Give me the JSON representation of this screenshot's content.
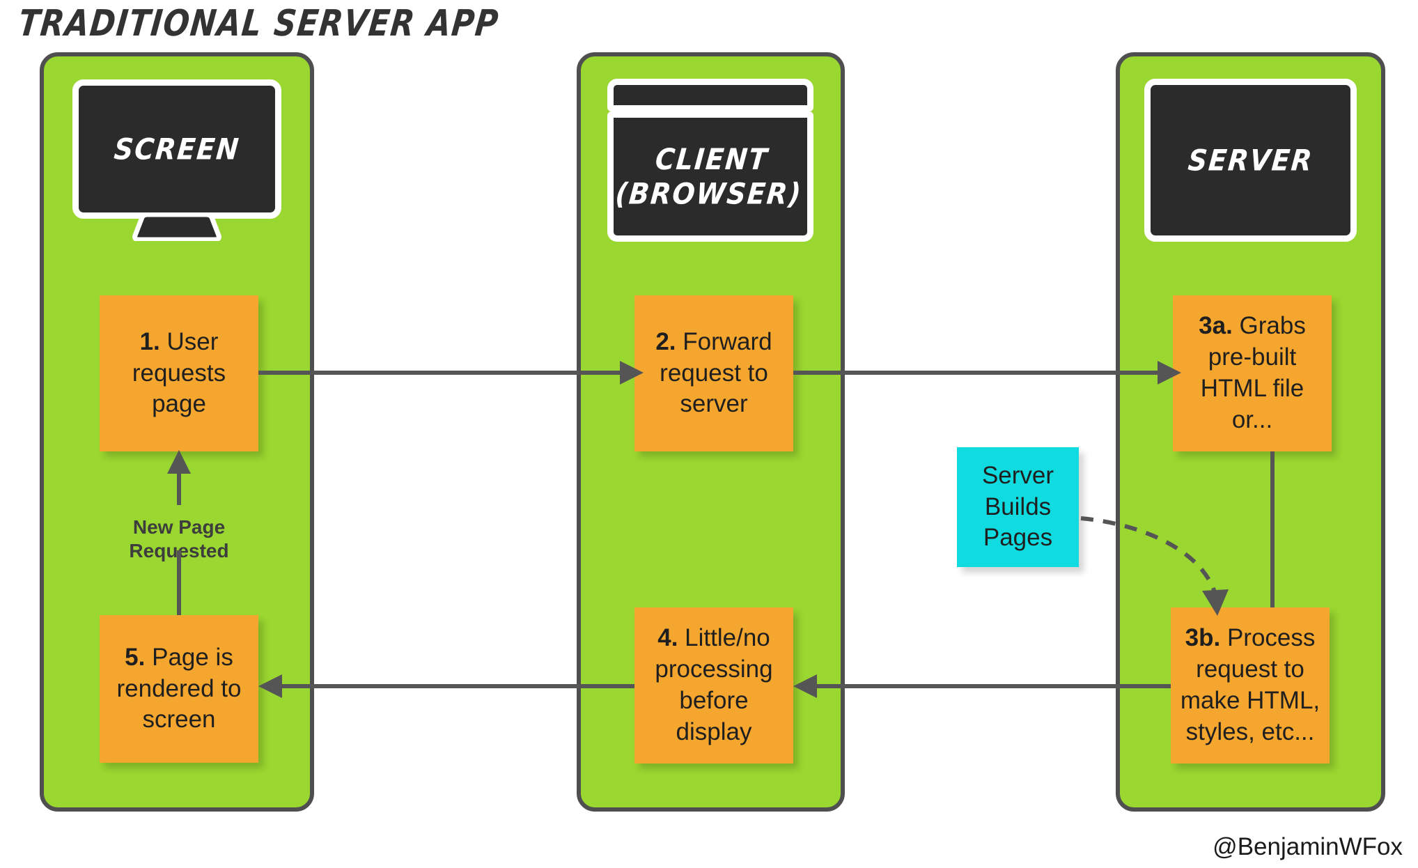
{
  "title": "TRADITIONAL SERVER APP",
  "attribution": "@BenjaminWFox",
  "colors": {
    "lane_green": "#9ad730",
    "lane_border": "#4f4f4f",
    "step_orange": "#f5a62e",
    "note_cyan": "#0fdbe0",
    "device_dark": "#2b2b2b",
    "connector_gray": "#555555",
    "text_dark": "#1f1f1f",
    "device_label_white": "#ffffff"
  },
  "lanes": [
    {
      "id": "screen",
      "device_label": "SCREEN",
      "device_icon": "monitor-icon",
      "steps": [
        {
          "id": "step1",
          "number": "1.",
          "text": "User requests page",
          "full": "1. User requests page"
        },
        {
          "id": "step5",
          "number": "5.",
          "text": "Page is rendered to screen",
          "full": "5. Page is rendered to screen"
        }
      ],
      "lane_label": "New Page Requested"
    },
    {
      "id": "client",
      "device_label": "CLIENT (BROWSER)",
      "device_label_line1": "CLIENT",
      "device_label_line2": "(BROWSER)",
      "device_icon": "browser-window-icon",
      "steps": [
        {
          "id": "step2",
          "number": "2.",
          "text": "Forward request to server",
          "full": "2. Forward request to server"
        },
        {
          "id": "step4",
          "number": "4.",
          "text": "Little/no processing before display",
          "full": "4. Little/no processing before display"
        }
      ]
    },
    {
      "id": "server",
      "device_label": "SERVER",
      "device_icon": "server-screen-icon",
      "steps": [
        {
          "id": "step3a",
          "number": "3a.",
          "text": "Grabs pre-built HTML file or...",
          "full": "3a. Grabs pre-built HTML file or..."
        },
        {
          "id": "step3b",
          "number": "3b.",
          "text": "Process request to make HTML, styles, etc...",
          "full": "3b. Process request to make HTML, styles, etc..."
        }
      ]
    }
  ],
  "notes": [
    {
      "id": "server-builds-pages",
      "text": "Server Builds Pages",
      "line1": "Server",
      "line2": "Builds",
      "line3": "Pages"
    }
  ],
  "connectors": [
    {
      "id": "step1-to-step2",
      "from": "step1",
      "to": "step2",
      "style": "solid",
      "direction": "right"
    },
    {
      "id": "step2-to-step3a",
      "from": "step2",
      "to": "step3a",
      "style": "solid",
      "direction": "right"
    },
    {
      "id": "step3a-to-step3b",
      "from": "step3a",
      "to": "step3b",
      "style": "solid",
      "direction": "none"
    },
    {
      "id": "step3b-to-step4",
      "from": "step3b",
      "to": "step4",
      "style": "solid",
      "direction": "left"
    },
    {
      "id": "step4-to-step5",
      "from": "step4",
      "to": "step5",
      "style": "solid",
      "direction": "left"
    },
    {
      "id": "step5-to-step1",
      "from": "step5",
      "to": "step1",
      "style": "solid",
      "direction": "up",
      "label": "New Page Requested"
    },
    {
      "id": "note-to-step3b",
      "from": "server-builds-pages",
      "to": "step3b",
      "style": "dashed",
      "direction": "curve-down-right"
    }
  ]
}
